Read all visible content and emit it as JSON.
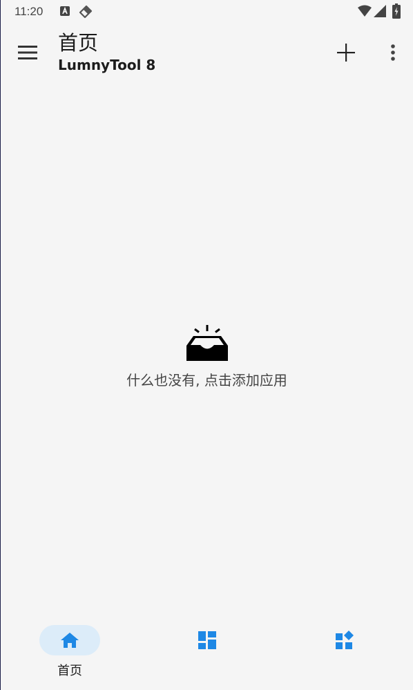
{
  "status_bar": {
    "time": "11:20",
    "icons": [
      "a-notification-icon",
      "tag-icon",
      "wifi-icon",
      "signal-icon",
      "battery-icon"
    ]
  },
  "app_bar": {
    "title": "首页",
    "subtitle": "LumnyTool 8",
    "icons": [
      "menu-icon",
      "plus-icon",
      "more-vert-icon"
    ]
  },
  "empty_state": {
    "icon": "empty-inbox-icon",
    "message": "什么也没有, 点击添加应用"
  },
  "bottom_nav": {
    "items": [
      {
        "label": "首页",
        "icon": "home-icon",
        "active": true
      },
      {
        "label": "",
        "icon": "dashboard-icon",
        "active": false
      },
      {
        "label": "",
        "icon": "widgets-icon",
        "active": false
      }
    ]
  },
  "colors": {
    "background": "#f5f5f5",
    "accent": "#1e88e5",
    "active_pill": "#dcecf9",
    "text_primary": "#1c1c1c",
    "text_secondary": "#444444"
  }
}
